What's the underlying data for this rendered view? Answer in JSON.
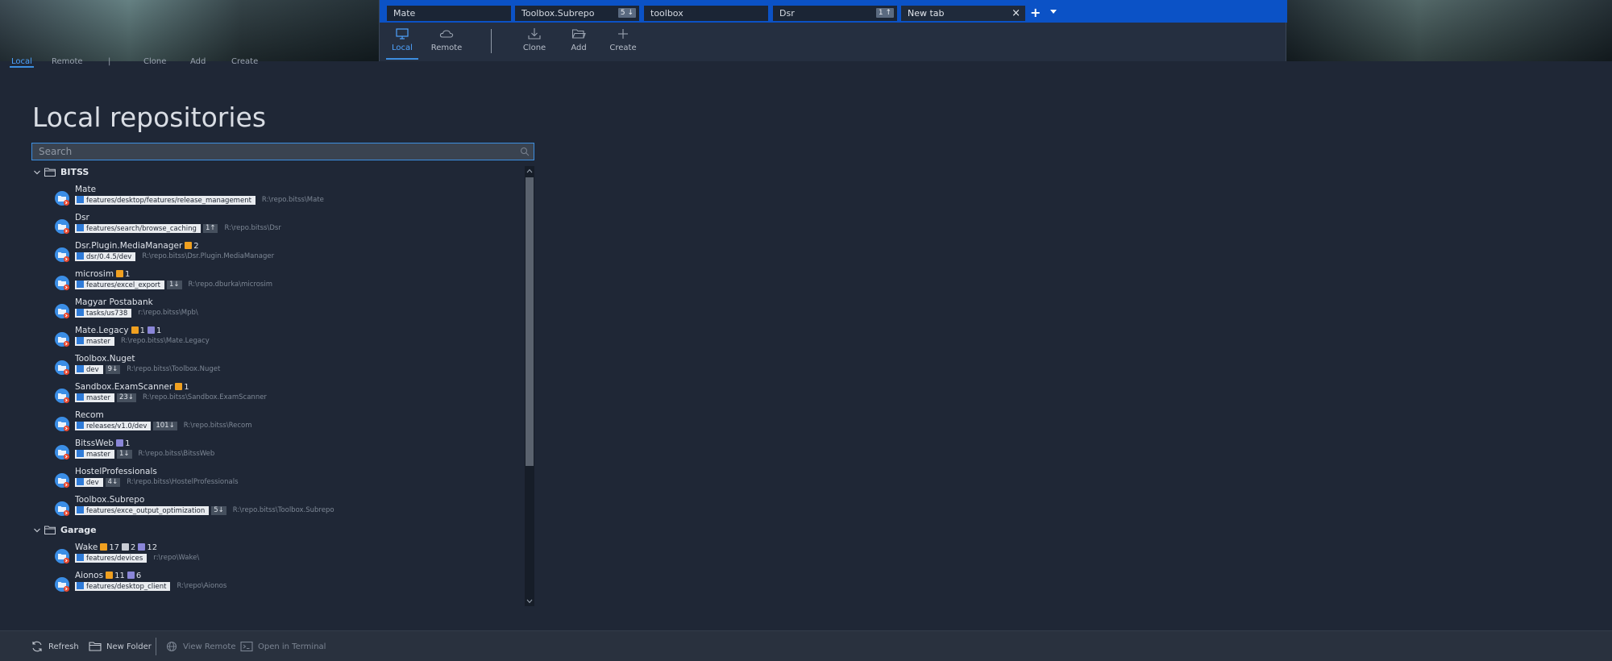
{
  "window": {
    "tabs": [
      {
        "label": "Mate",
        "badge": ""
      },
      {
        "label": "Toolbox.Subrepo",
        "badge": "5 ↓"
      },
      {
        "label": "toolbox",
        "badge": ""
      },
      {
        "label": "Dsr",
        "badge": "1 ↑"
      },
      {
        "label": "New tab",
        "badge": ""
      }
    ],
    "toolbar": {
      "local": "Local",
      "remote": "Remote",
      "clone": "Clone",
      "add": "Add",
      "create": "Create"
    }
  },
  "behind_nav": {
    "local": "Local",
    "remote": "Remote",
    "sep": "|",
    "clone": "Clone",
    "add": "Add",
    "create": "Create"
  },
  "main": {
    "title": "Local repositories",
    "search_placeholder": "Search",
    "groups": [
      {
        "name": "BITSS",
        "repos": [
          {
            "name": "Mate",
            "stats": [],
            "branch": "features/desktop/features/release_management",
            "ahead": "",
            "path": "R:\\repo.bitss\\Mate"
          },
          {
            "name": "Dsr",
            "stats": [],
            "branch": "features/search/browse_caching",
            "ahead": "1↑",
            "path": "R:\\repo.bitss\\Dsr"
          },
          {
            "name": "Dsr.Plugin.MediaManager",
            "stats": [
              {
                "kind": "mod",
                "count": "2"
              }
            ],
            "branch": "dsr/0.4.5/dev",
            "ahead": "",
            "path": "R:\\repo.bitss\\Dsr.Plugin.MediaManager"
          },
          {
            "name": "microsim",
            "stats": [
              {
                "kind": "mod",
                "count": "1"
              }
            ],
            "branch": "features/excel_export",
            "ahead": "1↓",
            "path": "R:\\repo.dburka\\microsim"
          },
          {
            "name": "Magyar Postabank",
            "stats": [],
            "branch": "tasks/us738",
            "ahead": "",
            "path": "r:\\repo.bitss\\Mpb\\"
          },
          {
            "name": "Mate.Legacy",
            "stats": [
              {
                "kind": "mod",
                "count": "1"
              },
              {
                "kind": "unk",
                "count": "1"
              }
            ],
            "branch": "master",
            "ahead": "",
            "path": "R:\\repo.bitss\\Mate.Legacy"
          },
          {
            "name": "Toolbox.Nuget",
            "stats": [],
            "branch": "dev",
            "ahead": "9↓",
            "path": "R:\\repo.bitss\\Toolbox.Nuget"
          },
          {
            "name": "Sandbox.ExamScanner",
            "stats": [
              {
                "kind": "mod",
                "count": "1"
              }
            ],
            "branch": "master",
            "ahead": "23↓",
            "path": "R:\\repo.bitss\\Sandbox.ExamScanner"
          },
          {
            "name": "Recom",
            "stats": [],
            "branch": "releases/v1.0/dev",
            "ahead": "101↓",
            "path": "R:\\repo.bitss\\Recom"
          },
          {
            "name": "BitssWeb",
            "stats": [
              {
                "kind": "unk",
                "count": "1"
              }
            ],
            "branch": "master",
            "ahead": "1↓",
            "path": "R:\\repo.bitss\\BitssWeb"
          },
          {
            "name": "HostelProfessionals",
            "stats": [],
            "branch": "dev",
            "ahead": "4↓",
            "path": "R:\\repo.bitss\\HostelProfessionals"
          },
          {
            "name": "Toolbox.Subrepo",
            "stats": [],
            "branch": "features/exce_output_optimization",
            "ahead": "5↓",
            "path": "R:\\repo.bitss\\Toolbox.Subrepo"
          }
        ]
      },
      {
        "name": "Garage",
        "repos": [
          {
            "name": "Wake",
            "stats": [
              {
                "kind": "mod",
                "count": "17"
              },
              {
                "kind": "del",
                "count": "2"
              },
              {
                "kind": "unk",
                "count": "12"
              }
            ],
            "branch": "features/devices",
            "ahead": "",
            "path": "r:\\repo\\Wake\\"
          },
          {
            "name": "Aionos",
            "stats": [
              {
                "kind": "mod",
                "count": "11"
              },
              {
                "kind": "unk",
                "count": "6"
              }
            ],
            "branch": "features/desktop_client",
            "ahead": "",
            "path": "R:\\repo\\Aionos"
          }
        ]
      }
    ]
  },
  "bottom": {
    "refresh": "Refresh",
    "new_folder": "New Folder",
    "view_remote": "View Remote",
    "open_terminal": "Open in Terminal"
  },
  "colors": {
    "accent": "#3d8ee0",
    "tabbar": "#0b52c6",
    "modified": "#f0a020",
    "untracked": "#8a86d8"
  }
}
